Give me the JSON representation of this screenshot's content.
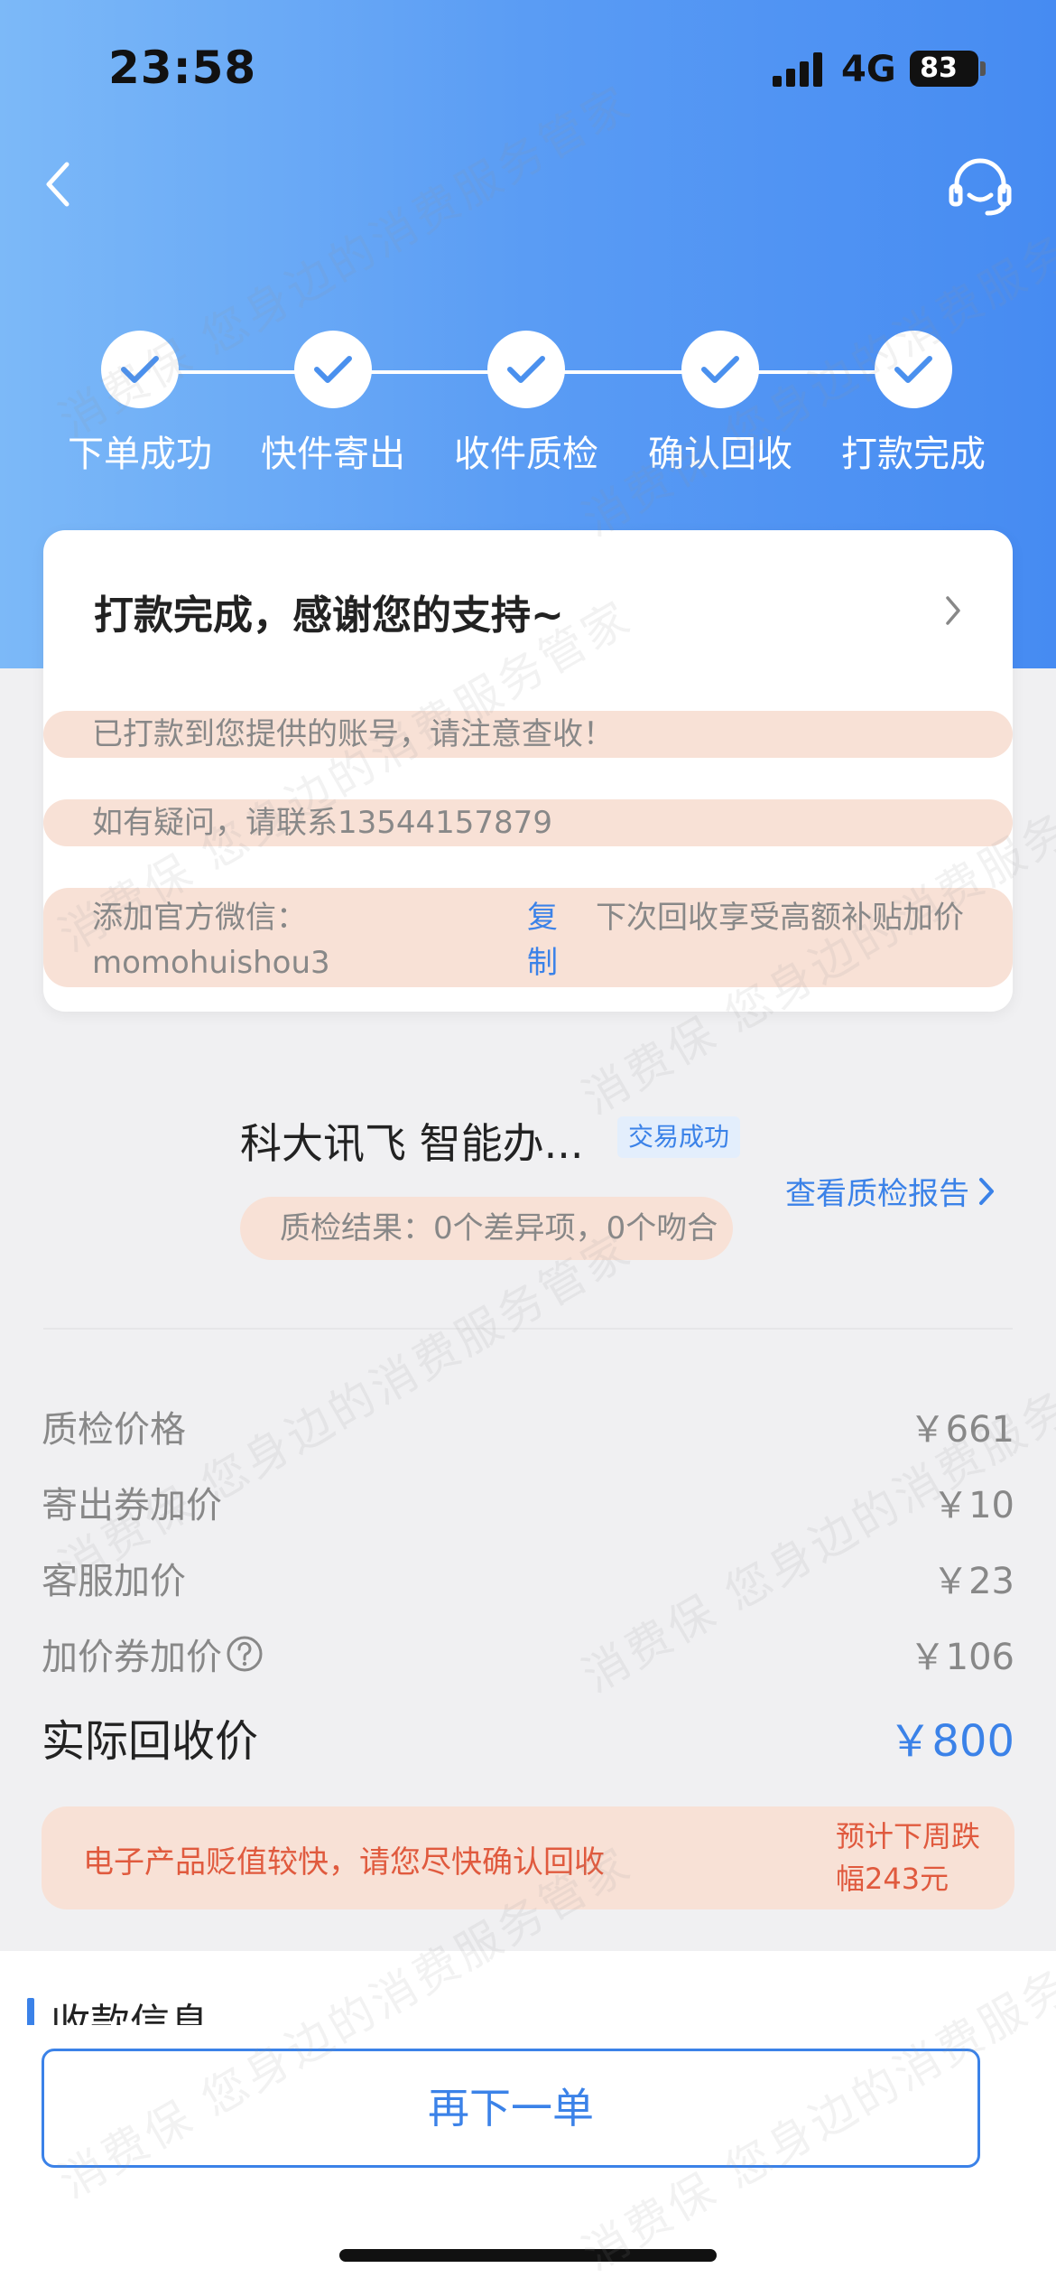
{
  "status_bar": {
    "time": "23:58",
    "network": "4G",
    "battery": "83"
  },
  "progress": {
    "steps": [
      {
        "label": "下单成功"
      },
      {
        "label": "快件寄出"
      },
      {
        "label": "收件质检"
      },
      {
        "label": "确认回收"
      },
      {
        "label": "打款完成"
      }
    ]
  },
  "card": {
    "title": "打款完成，感谢您的支持~",
    "notice1": "已打款到您提供的账号，请注意查收！",
    "notice2": "如有疑问，请联系13544157879",
    "wechat_label": "添加官方微信：momohuishou3",
    "copy_label": "复制",
    "bonus_text": "下次回收享受高额补贴加价"
  },
  "product": {
    "name": "科大讯飞 智能办...",
    "badge": "交易成功",
    "report_link": "查看质检报告",
    "qc_result": "质检结果：0个差异项，0个吻合"
  },
  "prices": [
    {
      "label": "质检价格",
      "value": "￥661"
    },
    {
      "label": "寄出券加价",
      "value": "￥10"
    },
    {
      "label": "客服加价",
      "value": "￥23"
    },
    {
      "label": "加价券加价",
      "value": "￥106"
    }
  ],
  "total": {
    "label": "实际回收价",
    "value": "￥800"
  },
  "warning": {
    "text": "电子产品贬值较快，请您尽快确认回收",
    "forecast": "预计下周跌幅243元"
  },
  "section_title": "收款信息",
  "reorder_button": "再下一单",
  "watermark": "消费保 您身边的消费服务管家",
  "colors": {
    "accent": "#3b82e8",
    "header": "#5a9cf4",
    "notice_bg": "#f8e1d6",
    "warning": "#e05a3e"
  }
}
